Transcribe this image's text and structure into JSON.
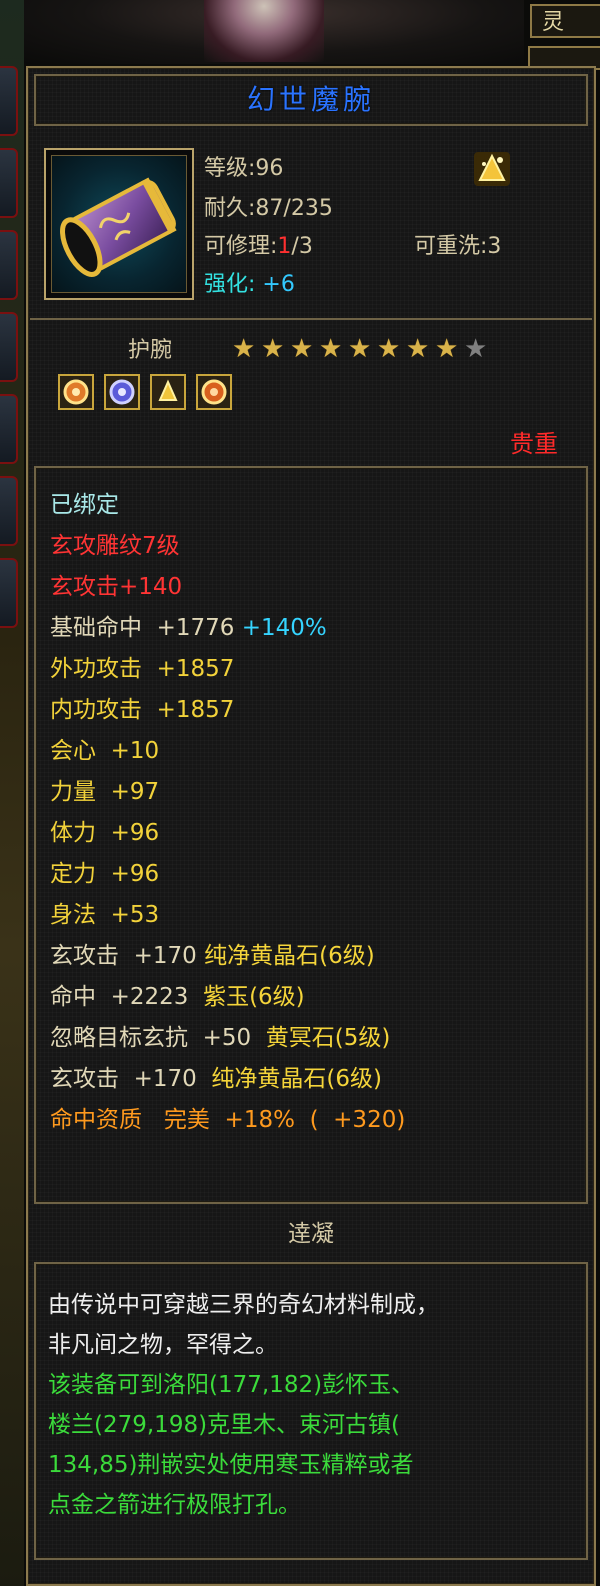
{
  "corner_button": "灵",
  "item": {
    "name": "幻世魔腕",
    "level_line": "等级:96",
    "durability_line": "耐久:87/235",
    "repair_prefix": "可修理:",
    "repair_current": "1",
    "repair_suffix": "/3",
    "rewash_line": "可重洗:3",
    "enhance_label": "强化:",
    "enhance_value": "+6",
    "type": "护腕",
    "stars_filled": 8,
    "stars_total": 9,
    "sockets": [
      "gem-yellow",
      "gem-purple",
      "gem-yellow",
      "gem-yellow"
    ],
    "rarity": "贵重"
  },
  "attributes": [
    {
      "text": "已绑定",
      "color": "c-cyan"
    },
    {
      "text": "玄攻雕纹7级",
      "color": "c-red"
    },
    {
      "text": "玄攻击+140",
      "color": "c-red"
    },
    {
      "text": "基础命中  +1776 ",
      "extra": "+140%",
      "color": "c-tan"
    },
    {
      "text": "外功攻击  +1857",
      "color": "c-yel"
    },
    {
      "text": "内功攻击  +1857",
      "color": "c-yel"
    },
    {
      "text": "会心  +10",
      "color": "c-yel"
    },
    {
      "text": "力量  +97",
      "color": "c-yel"
    },
    {
      "text": "体力  +96",
      "color": "c-yel"
    },
    {
      "text": "定力  +96",
      "color": "c-yel"
    },
    {
      "text": "身法  +53",
      "color": "c-yel"
    },
    {
      "text": "玄攻击  +170 ",
      "gem": "纯净黄晶石(6级)",
      "color": "c-tan"
    },
    {
      "text": "命中  +2223  ",
      "gem": "紫玉(6级)",
      "color": "c-tan"
    },
    {
      "text": "忽略目标玄抗  +50  ",
      "gem": "黄冥石(5级)",
      "color": "c-tan"
    },
    {
      "text": "玄攻击  +170  ",
      "gem": "纯净黄晶石(6级)",
      "color": "c-tan"
    },
    {
      "text": "命中资质   完美  +18%  (  +320)",
      "color": "c-org"
    }
  ],
  "quality": "逹凝",
  "description": [
    {
      "text": "由传说中可穿越三界的奇幻材料制成，",
      "color": "d-white"
    },
    {
      "text": "非凡间之物，罕得之。",
      "color": "d-white"
    },
    {
      "text": "该装备可到洛阳(177,182)彭怀玉、",
      "color": "d-green"
    },
    {
      "text": "楼兰(279,198)克里木、束河古镇(",
      "color": "d-green"
    },
    {
      "text": "134,85)荆嵌实处使用寒玉精粹或者",
      "color": "d-green"
    },
    {
      "text": "点金之箭进行极限打孔。",
      "color": "d-green"
    }
  ],
  "colors": {
    "name": "#2a73ff",
    "rarity": "#ff2a2a",
    "frame": "#8c7a4e"
  }
}
